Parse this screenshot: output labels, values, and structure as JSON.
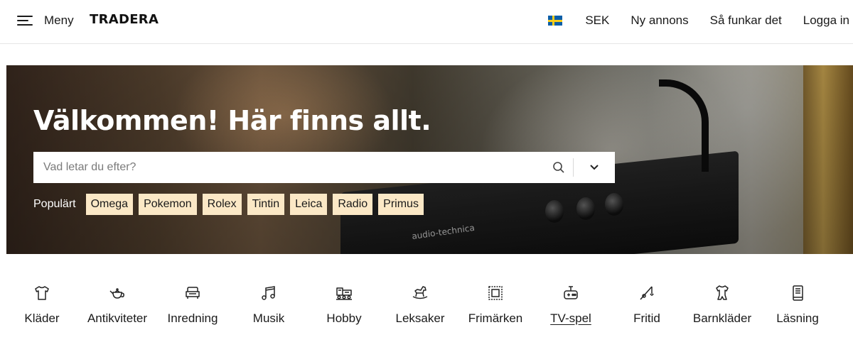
{
  "header": {
    "menu_label": "Meny",
    "logo": "TRADERA",
    "flag_icon": "sweden-flag-icon",
    "currency": "SEK",
    "new_listing": "Ny annons",
    "how_it_works": "Så funkar det",
    "login": "Logga in"
  },
  "hero": {
    "title": "Välkommen! Här finns allt.",
    "search": {
      "placeholder": "Vad letar du efter?",
      "search_icon": "search-icon",
      "dropdown_icon": "chevron-down-icon"
    },
    "popular_label": "Populärt",
    "popular_items": [
      "Omega",
      "Pokemon",
      "Rolex",
      "Tintin",
      "Leica",
      "Radio",
      "Primus"
    ],
    "image_text": "audio-technica"
  },
  "categories": [
    {
      "label": "Kläder",
      "icon": "tshirt-icon"
    },
    {
      "label": "Antikviteter",
      "icon": "teapot-icon"
    },
    {
      "label": "Inredning",
      "icon": "armchair-icon"
    },
    {
      "label": "Musik",
      "icon": "music-note-icon"
    },
    {
      "label": "Hobby",
      "icon": "train-icon"
    },
    {
      "label": "Leksaker",
      "icon": "rocking-horse-icon"
    },
    {
      "label": "Frimärken",
      "icon": "stamp-icon"
    },
    {
      "label": "TV-spel",
      "icon": "gamepad-icon",
      "active": true
    },
    {
      "label": "Fritid",
      "icon": "fishing-rod-icon"
    },
    {
      "label": "Barnkläder",
      "icon": "baby-clothes-icon"
    },
    {
      "label": "Läsning",
      "icon": "book-icon"
    }
  ]
}
